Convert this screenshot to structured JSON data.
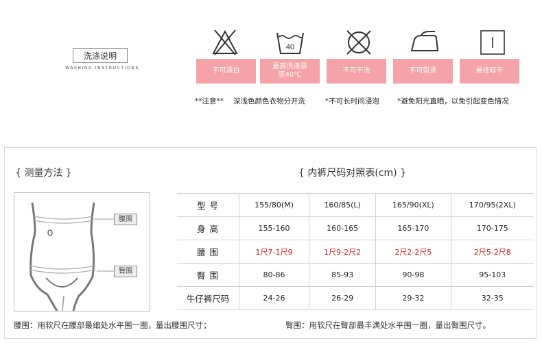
{
  "washing": {
    "title": "洗涤说明",
    "subtitle": "WASHING INSTRUCTIONS",
    "icons": [
      {
        "name": "no-bleach-icon",
        "label": "不可漂白"
      },
      {
        "name": "wash-40-icon",
        "label": "最高洗涤温度40℃",
        "temp": "40"
      },
      {
        "name": "no-dry-clean-icon",
        "label": "不可干洗"
      },
      {
        "name": "no-iron-icon",
        "label": "不可熨烫"
      },
      {
        "name": "hang-dry-icon",
        "label": "悬挂晾干"
      }
    ],
    "notes": [
      "**注意**",
      "深浅色颜色衣物分开洗",
      "*不可长时间浸泡",
      "*避免阳光直晒，以免引起变色情况"
    ]
  },
  "measure": {
    "heading": "{  测量方法  }",
    "waist_tag": "腰围",
    "hip_tag": "臀围"
  },
  "size_table": {
    "heading": "{  内裤尺码对照表(cm)  }",
    "rows": [
      {
        "label": "型  号",
        "values": [
          "155/80(M)",
          "160/85(L)",
          "165/90(XL)",
          "170/95(2XL)"
        ]
      },
      {
        "label": "身  高",
        "values": [
          "155-160",
          "160-165",
          "165-170",
          "170-175"
        ]
      },
      {
        "label": "腰  围",
        "values": [
          "1尺7-1尺9",
          "1尺9-2尺2",
          "2尺2-2尺5",
          "2尺5-2尺8"
        ]
      },
      {
        "label": "臀  围",
        "values": [
          "80-86",
          "85-93",
          "90-98",
          "95-103"
        ]
      },
      {
        "label": "牛仔裤尺码",
        "values": [
          "24-26",
          "26-29",
          "29-32",
          "32-35"
        ]
      }
    ]
  },
  "footer": {
    "waist_note": "腰围：用软尺在腰部最细处水平围一圈，量出腰围尺寸；",
    "hip_note": "臀围：用软尺在臀部最丰满处水平围一圈，量出臀围尺寸。"
  },
  "colors": {
    "label_bg": "#f4a3a8",
    "accent_red": "#d82020"
  }
}
